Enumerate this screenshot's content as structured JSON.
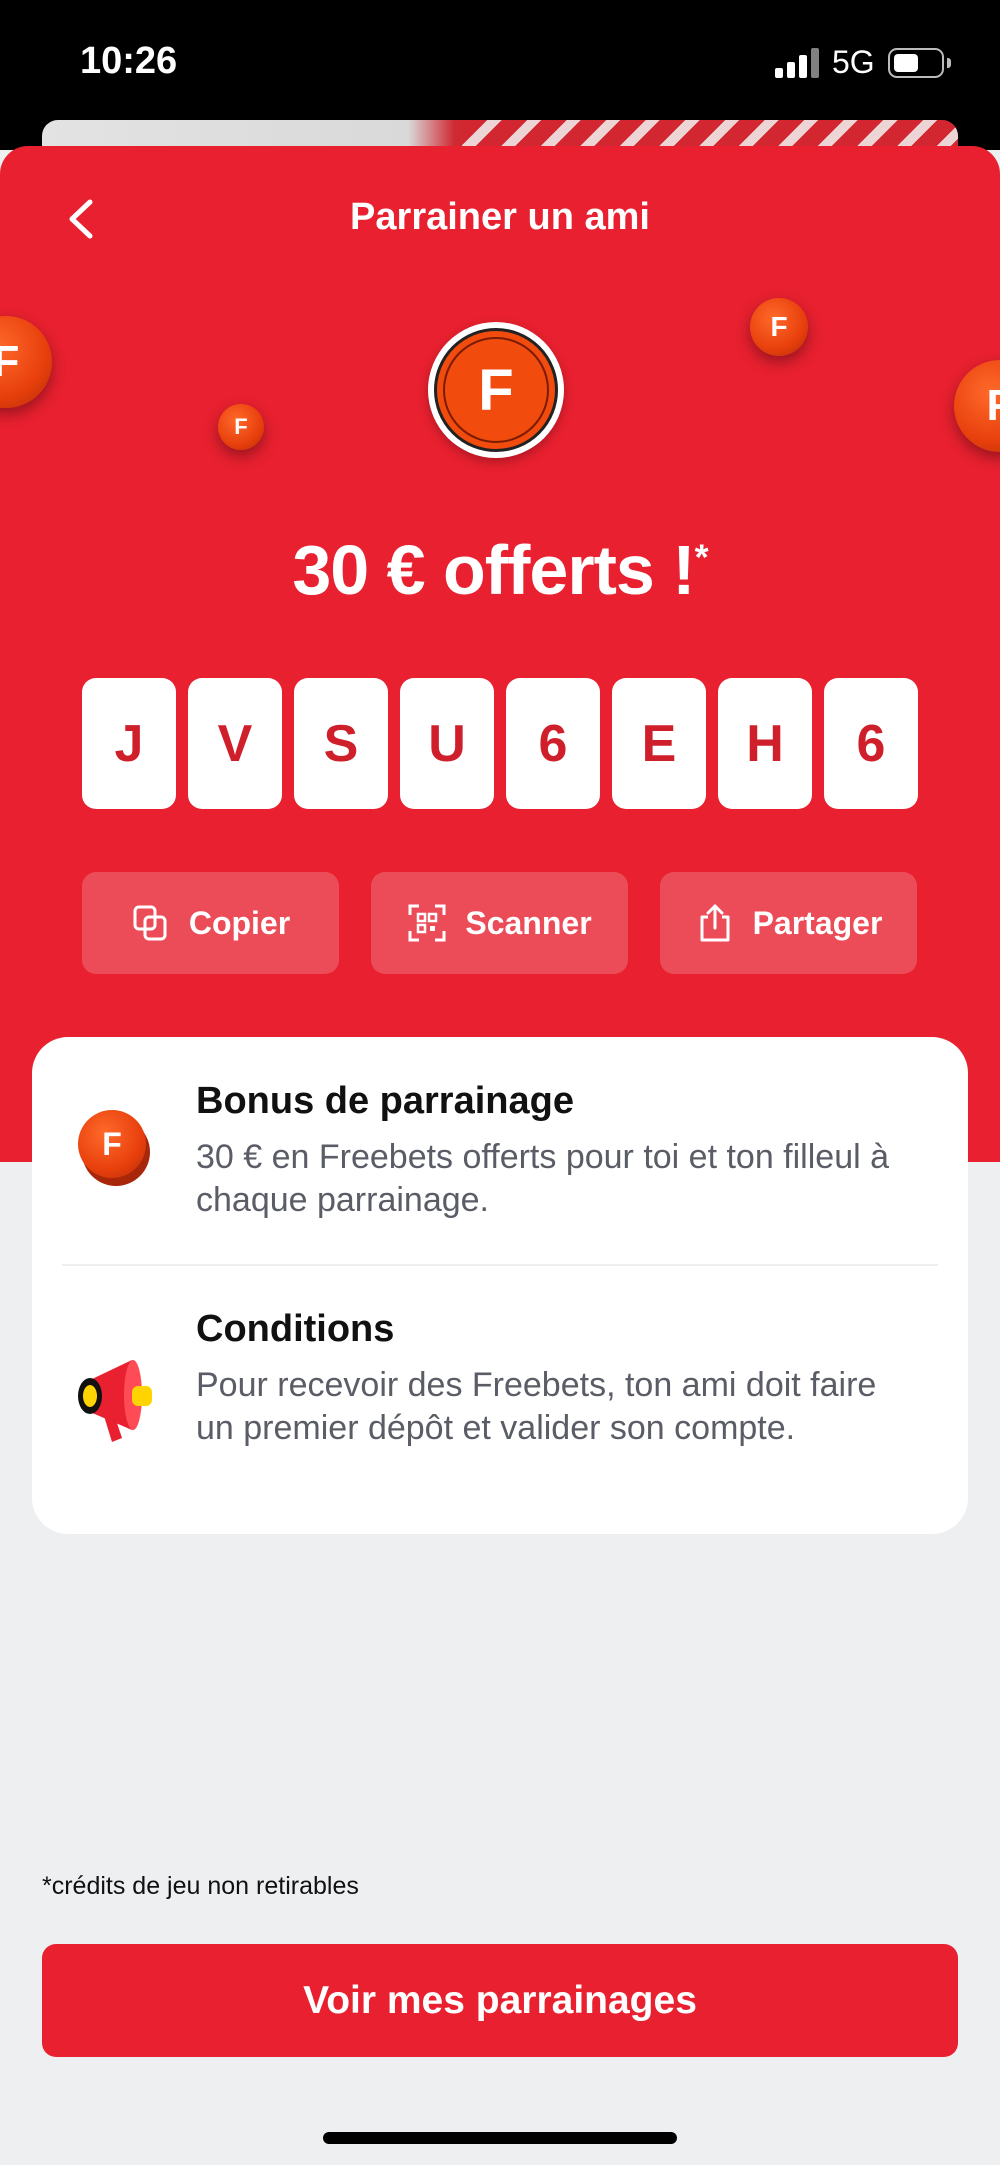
{
  "status_bar": {
    "time": "10:26",
    "network": "5G"
  },
  "header": {
    "title": "Parrainer un ami"
  },
  "logo_letter": "F",
  "offer": {
    "headline": "30 € offerts !",
    "asterisk": "*"
  },
  "code": [
    "J",
    "V",
    "S",
    "U",
    "6",
    "E",
    "H",
    "6"
  ],
  "actions": {
    "copy": "Copier",
    "scan": "Scanner",
    "share": "Partager"
  },
  "info": [
    {
      "title": "Bonus de parrainage",
      "text": "30 € en Freebets offerts pour toi et ton filleul à chaque parrainage.",
      "icon": "coin-icon"
    },
    {
      "title": "Conditions",
      "text": "Pour recevoir des Freebets, ton ami doit faire un premier dépôt et valider son compte.",
      "icon": "megaphone-icon"
    }
  ],
  "footnote": "*crédits de jeu non retirables",
  "cta": "Voir mes parrainages",
  "colors": {
    "brand_red": "#e8202f",
    "coin_orange": "#f14b0e",
    "code_text": "#cf1f2b"
  }
}
